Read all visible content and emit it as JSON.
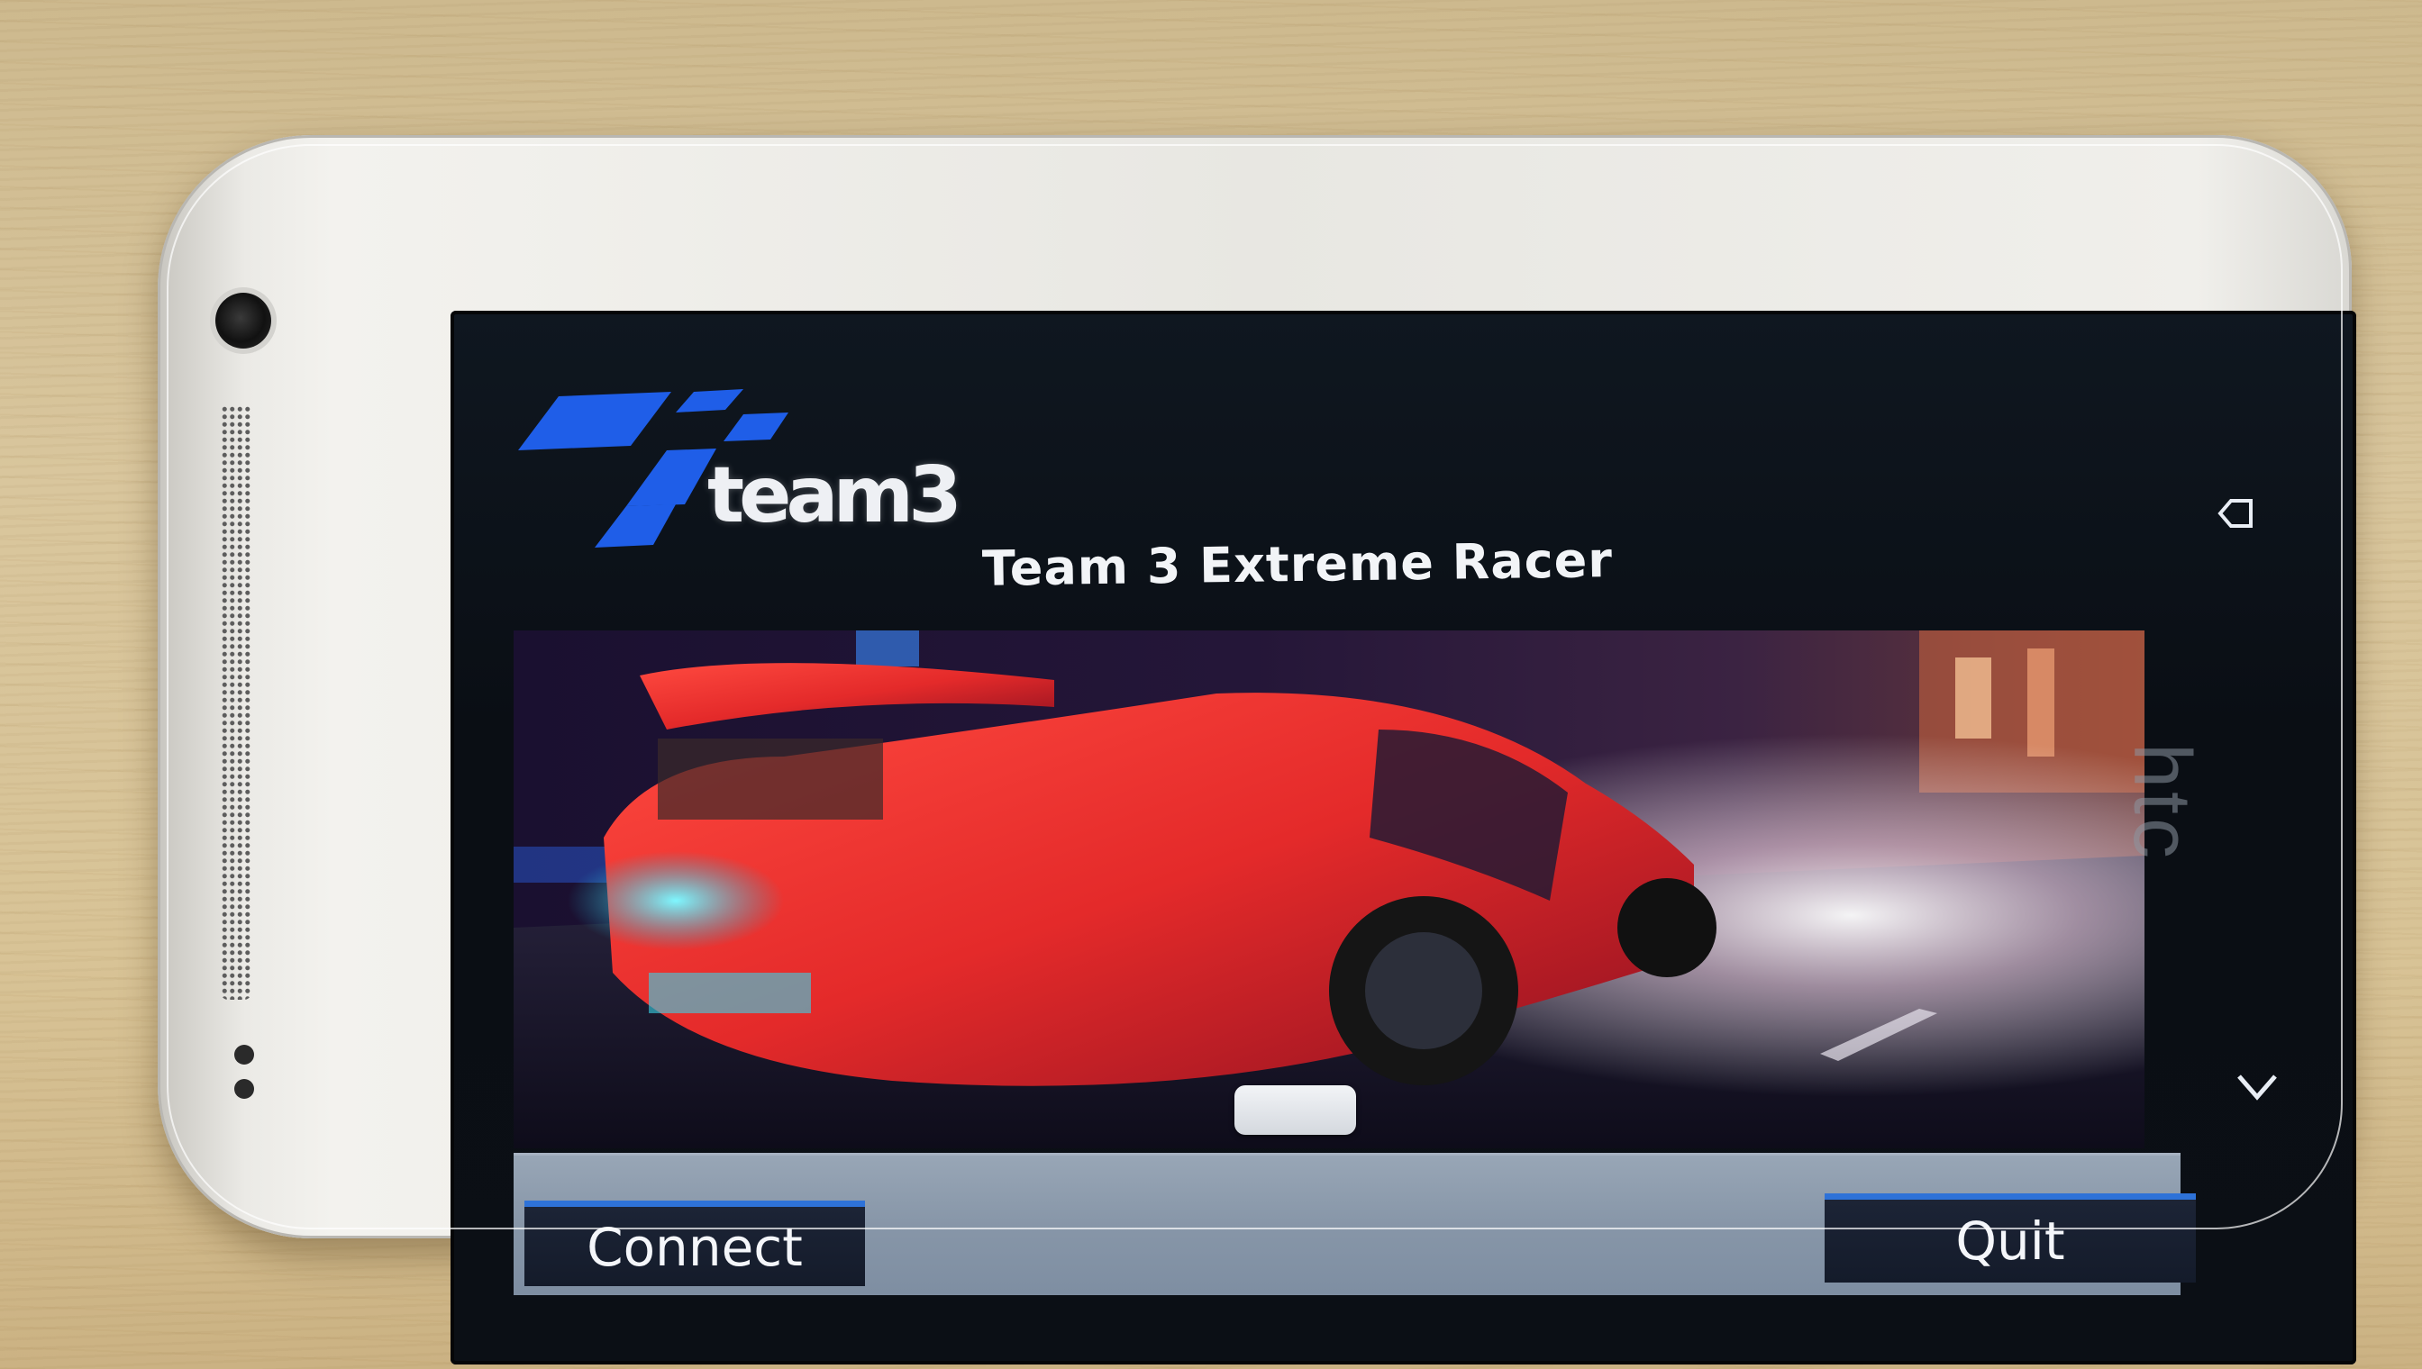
{
  "app": {
    "title": "Team 3 Extreme Racer",
    "logo_text": "team3"
  },
  "buttons": {
    "connect_label": "Connect",
    "quit_label": "Quit"
  },
  "device": {
    "brand_text": "htc"
  },
  "icons": {
    "back": "back-icon",
    "down": "chevron-down-icon",
    "logo": "checkered-flag-icon"
  },
  "colors": {
    "logo_blue": "#1f5ee8",
    "button_accent": "#2e72d8",
    "button_bg": "#1a2233",
    "bar_bg": "#8a99ab",
    "car_red": "#e42a2a"
  }
}
